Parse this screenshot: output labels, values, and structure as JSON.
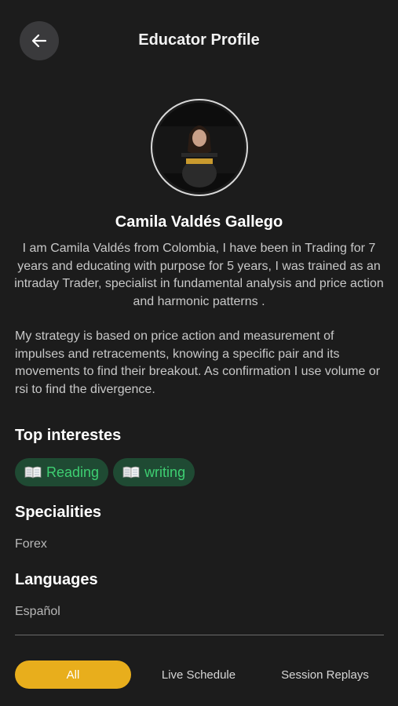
{
  "header": {
    "title": "Educator Profile",
    "back_icon": "arrow-left-icon"
  },
  "profile": {
    "name": "Camila Valdés Gallego",
    "bio_intro": "I am Camila Valdés from Colombia, I have been in Trading for 7 years and educating with purpose for 5 years, I was trained as an intraday Trader, specialist in fundamental analysis and price action and harmonic patterns .",
    "bio_strategy": "My strategy is based on price action and measurement of impulses and retracements, knowing a specific pair and its movements to find their breakout. As confirmation I use volume or rsi to find the divergence."
  },
  "interests": {
    "title": "Top interestes",
    "items": [
      {
        "label": "Reading",
        "icon": "open-book-icon"
      },
      {
        "label": "writing",
        "icon": "open-book-icon"
      }
    ]
  },
  "specialities": {
    "title": "Specialities",
    "value": "Forex"
  },
  "languages": {
    "title": "Languages",
    "value": "Español"
  },
  "tabs": [
    {
      "label": "All",
      "active": true
    },
    {
      "label": "Live Schedule",
      "active": false
    },
    {
      "label": "Session Replays",
      "active": false
    }
  ],
  "colors": {
    "background": "#1c1c1c",
    "accent": "#e8ae1c",
    "chip_bg": "#1f4a33",
    "chip_text": "#3ecf72"
  }
}
